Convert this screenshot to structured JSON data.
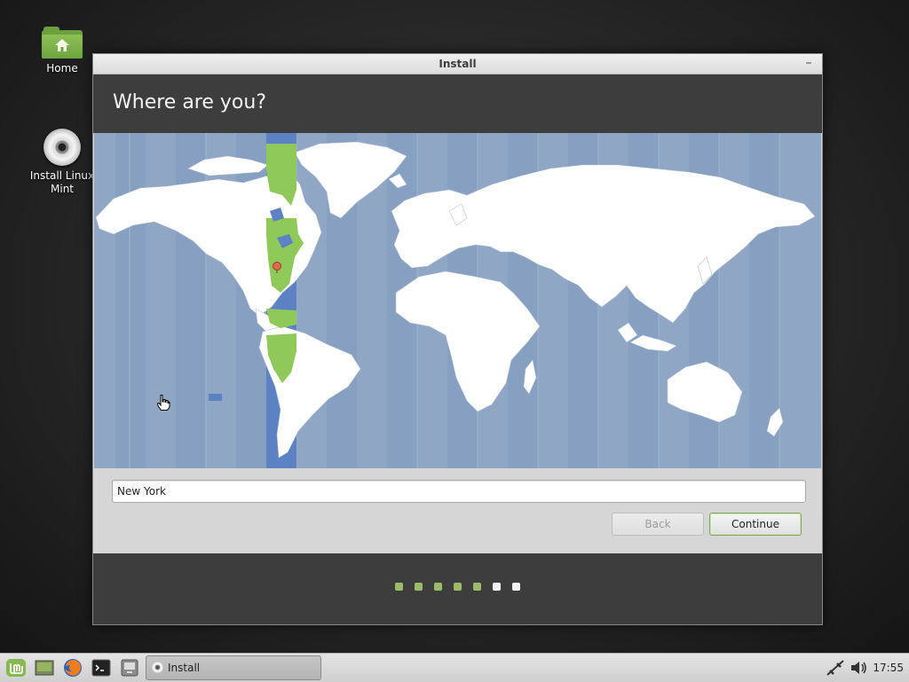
{
  "desktop": {
    "icons": [
      {
        "label": "Home",
        "icon": "home-folder-icon"
      },
      {
        "label": "Install Linux Mint",
        "icon": "install-disc-icon"
      }
    ]
  },
  "window": {
    "title": "Install",
    "minimize_glyph": "–",
    "header_title": "Where are you?",
    "location_value": "New York",
    "back_label": "Back",
    "continue_label": "Continue",
    "progress": {
      "total_steps": 7,
      "completed_steps": 5
    }
  },
  "taskbar": {
    "launchers": [
      "mint-menu-icon",
      "show-desktop-icon",
      "firefox-icon",
      "terminal-icon",
      "files-icon"
    ],
    "task_label": "Install",
    "tray": [
      "network-icon",
      "volume-icon"
    ],
    "clock": "17:55"
  },
  "colors": {
    "accent": "#8cc157",
    "header_bg": "#3d3d3d",
    "ocean": "#8fa6c5",
    "timezone_highlight": "#5c82c4",
    "selected_zone_land": "#8fc95a"
  }
}
